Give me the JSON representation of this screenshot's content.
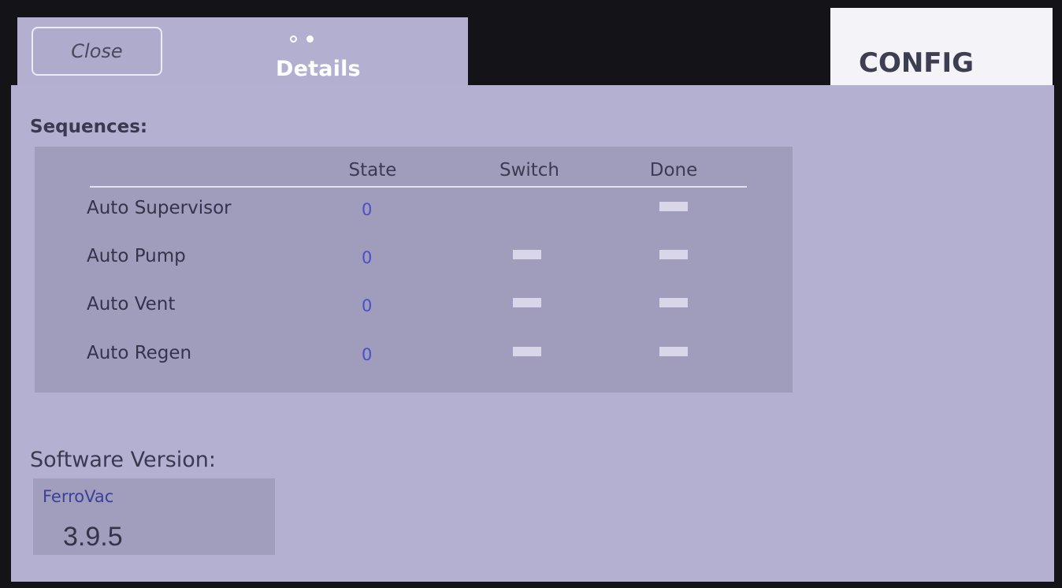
{
  "header": {
    "close_label": "Close",
    "tab_title": "Details",
    "page_dots": [
      "empty",
      "filled"
    ],
    "config_label": "CONFIG"
  },
  "sequences": {
    "title": "Sequences:",
    "columns": [
      "State",
      "Switch",
      "Done"
    ],
    "rows": [
      {
        "name": "Auto Supervisor",
        "state": "0",
        "switch": false,
        "done": true
      },
      {
        "name": "Auto Pump",
        "state": "0",
        "switch": true,
        "done": true
      },
      {
        "name": "Auto Vent",
        "state": "0",
        "switch": true,
        "done": true
      },
      {
        "name": "Auto Regen",
        "state": "0",
        "switch": true,
        "done": true
      }
    ]
  },
  "software": {
    "title": "Software Version:",
    "product": "FerroVac",
    "version": "3.9.5"
  },
  "colors": {
    "panel": "#b3b0d1",
    "table_bg": "#9f9cbc",
    "state_value": "#4b4fcb",
    "indicator_off": "#d8d6e8",
    "config_tab": "#f3f3f8"
  }
}
